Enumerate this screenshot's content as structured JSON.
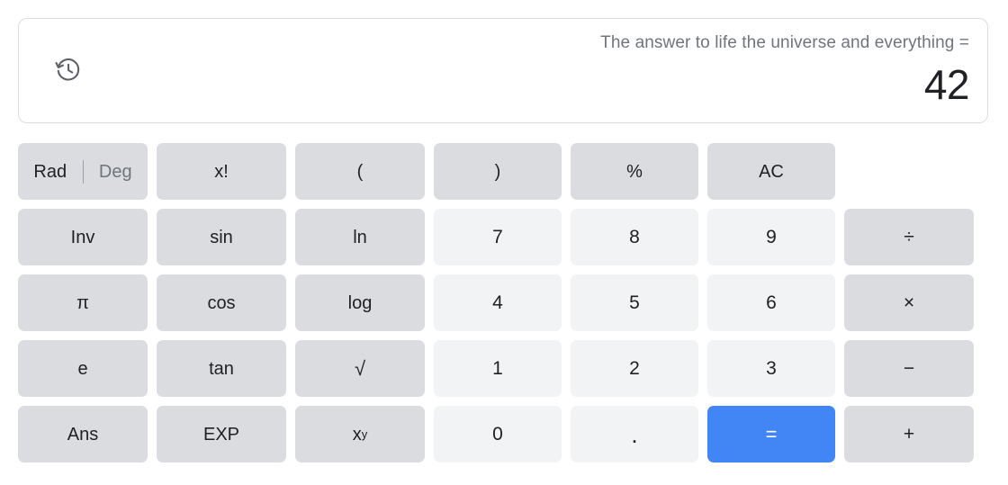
{
  "display": {
    "history_icon": "history-clock-icon",
    "expression": "The answer to life the universe and everything =",
    "result": "42"
  },
  "angle_mode": {
    "rad_label": "Rad",
    "deg_label": "Deg",
    "selected": "Rad"
  },
  "colors": {
    "accent_blue": "#4285f4",
    "function_key": "#dadce0",
    "number_key": "#f1f3f4",
    "text_primary": "#202124",
    "text_secondary": "#70757a",
    "card_border": "#dadce0"
  },
  "keys": {
    "factorial": "x!",
    "paren_open": "(",
    "paren_close": ")",
    "percent": "%",
    "all_clear": "AC",
    "inverse": "Inv",
    "sin": "sin",
    "ln": "ln",
    "seven": "7",
    "eight": "8",
    "nine": "9",
    "divide": "÷",
    "pi": "π",
    "cos": "cos",
    "log": "log",
    "four": "4",
    "five": "5",
    "six": "6",
    "multiply": "×",
    "e": "e",
    "tan": "tan",
    "sqrt": "√",
    "one": "1",
    "two": "2",
    "three": "3",
    "minus": "−",
    "answer": "Ans",
    "exp": "EXP",
    "power_base": "x",
    "power_exponent": "y",
    "zero": "0",
    "decimal": ".",
    "equals": "=",
    "plus": "+"
  }
}
